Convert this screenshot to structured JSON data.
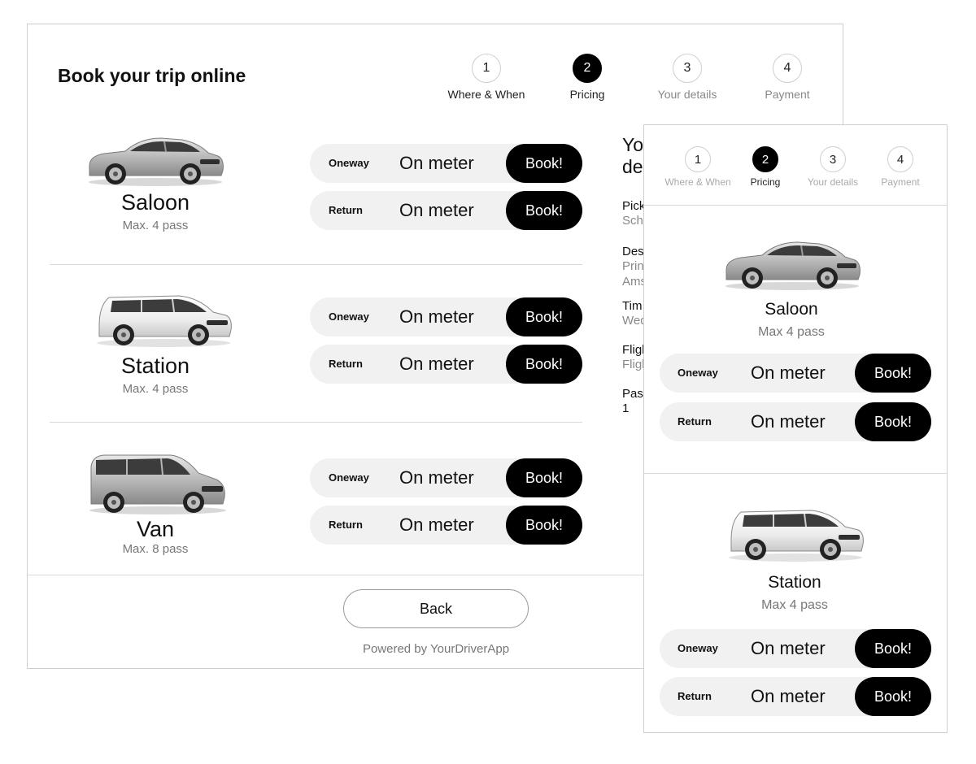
{
  "desktop": {
    "title": "Book your trip online",
    "steps": [
      {
        "number": "1",
        "label": "Where & When"
      },
      {
        "number": "2",
        "label": "Pricing"
      },
      {
        "number": "3",
        "label": "Your details"
      },
      {
        "number": "4",
        "label": "Payment"
      }
    ],
    "active_step": 2,
    "vehicles": [
      {
        "name": "Saloon",
        "capacity": "Max. 4 pass",
        "options": [
          {
            "type": "Oneway",
            "price": "On meter",
            "button": "Book!"
          },
          {
            "type": "Return",
            "price": "On meter",
            "button": "Book!"
          }
        ]
      },
      {
        "name": "Station",
        "capacity": "Max. 4 pass",
        "options": [
          {
            "type": "Oneway",
            "price": "On meter",
            "button": "Book!"
          },
          {
            "type": "Return",
            "price": "On meter",
            "button": "Book!"
          }
        ]
      },
      {
        "name": "Van",
        "capacity": "Max. 8 pass",
        "options": [
          {
            "type": "Oneway",
            "price": "On meter",
            "button": "Book!"
          },
          {
            "type": "Return",
            "price": "On meter",
            "button": "Book!"
          }
        ]
      }
    ],
    "details_panel": {
      "title_line1": "Yo",
      "title_line2": "de",
      "fields": [
        {
          "label": "Pick",
          "values": [
            "Sch"
          ]
        },
        {
          "label": "Des",
          "values": [
            "Prin",
            "Ams"
          ]
        },
        {
          "label": "Tim",
          "values": [
            "Wed"
          ]
        },
        {
          "label": "Fligl",
          "values": [
            "Fligl"
          ]
        },
        {
          "label": "Pas",
          "values": [
            "1"
          ]
        }
      ]
    },
    "back_label": "Back",
    "powered_by": "Powered by YourDriverApp"
  },
  "mobile": {
    "steps": [
      {
        "number": "1",
        "label": "Where & When"
      },
      {
        "number": "2",
        "label": "Pricing"
      },
      {
        "number": "3",
        "label": "Your details"
      },
      {
        "number": "4",
        "label": "Payment"
      }
    ],
    "active_step": 2,
    "vehicles": [
      {
        "name": "Saloon",
        "capacity": "Max 4 pass",
        "options": [
          {
            "type": "Oneway",
            "price": "On meter",
            "button": "Book!"
          },
          {
            "type": "Return",
            "price": "On meter",
            "button": "Book!"
          }
        ]
      },
      {
        "name": "Station",
        "capacity": "Max 4 pass",
        "options": [
          {
            "type": "Oneway",
            "price": "On meter",
            "button": "Book!"
          },
          {
            "type": "Return",
            "price": "On meter",
            "button": "Book!"
          }
        ]
      }
    ]
  },
  "colors": {
    "accent": "#000000",
    "row_bg": "#f1f1f1",
    "muted_text": "#888888",
    "border": "#cfcfcf"
  },
  "icons": [
    "sedan-car-image",
    "station-wagon-car-image",
    "van-car-image"
  ]
}
